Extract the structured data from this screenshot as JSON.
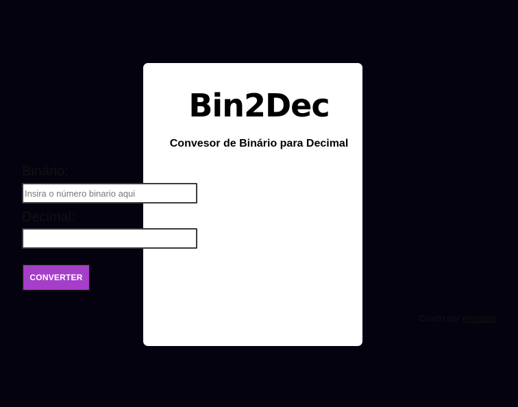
{
  "app": {
    "title": "Bin2Dec",
    "subtitle": "Convesor de Binário para Decimal"
  },
  "form": {
    "binario_label": "Binário:",
    "binario_placeholder": "Insira o número binario aqui",
    "binario_value": "",
    "decimal_label": "Decimal:",
    "decimal_placeholder": "",
    "decimal_value": "",
    "convert_label": "CONVERTER"
  },
  "footer": {
    "prefix": "Criado por",
    "author_link": "einasota"
  },
  "colors": {
    "background": "#04020f",
    "card": "#ffffff",
    "button": "#a53ec9"
  }
}
